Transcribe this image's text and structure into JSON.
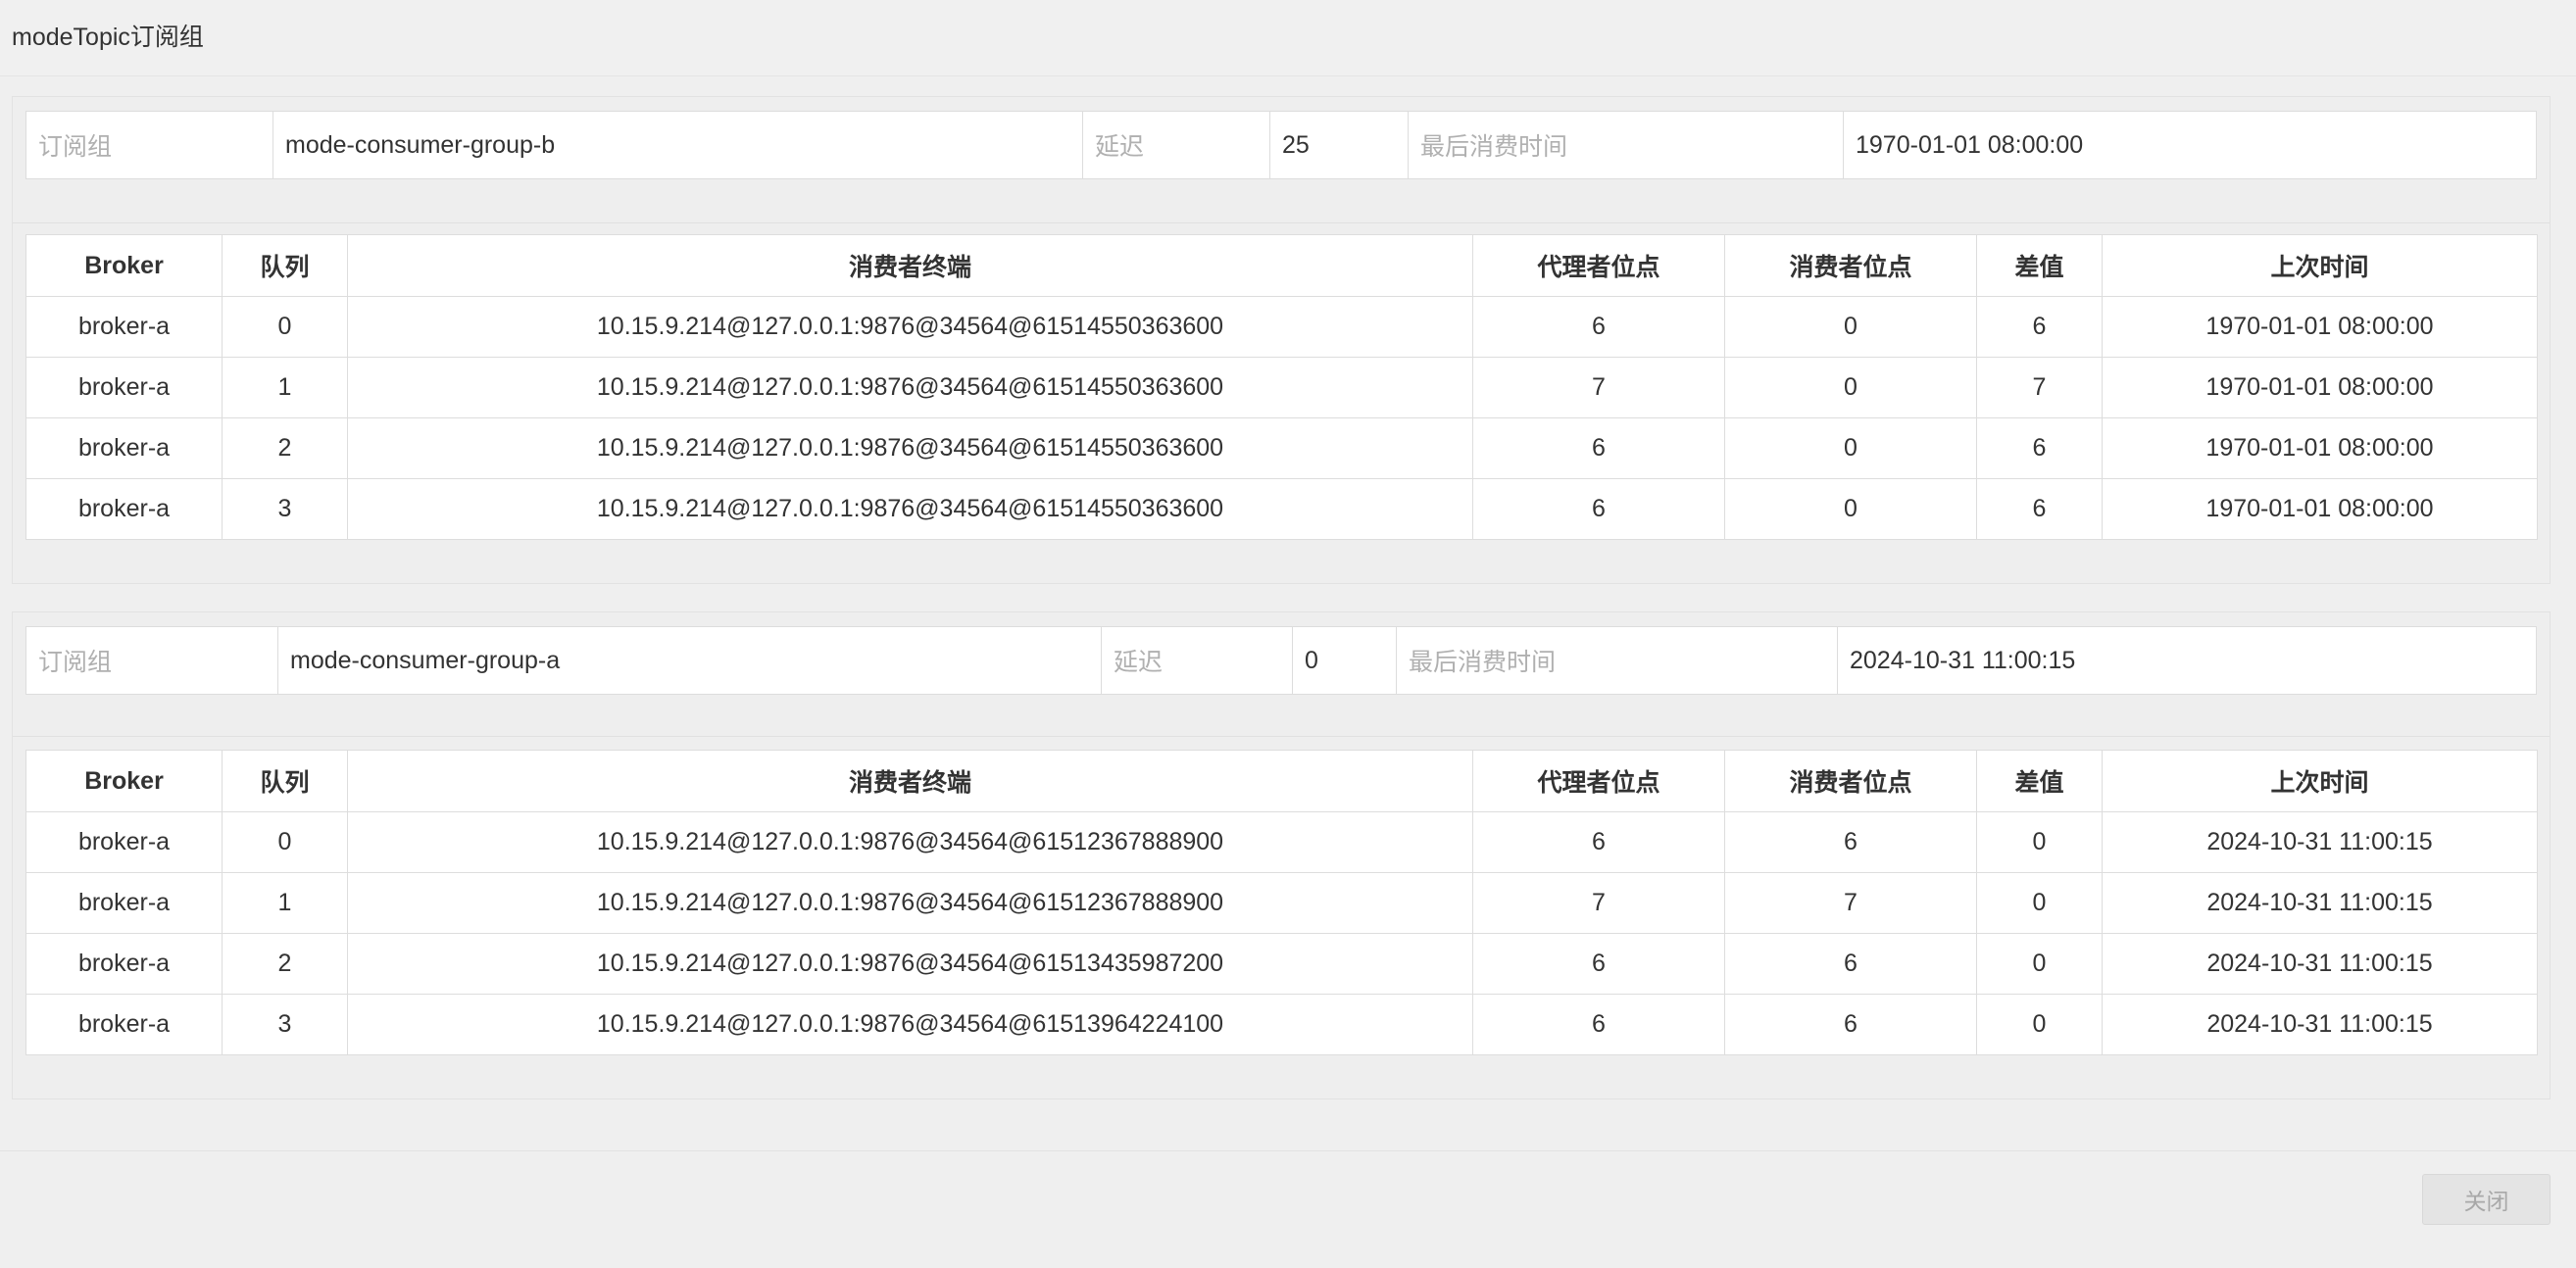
{
  "dialog": {
    "title": "modeTopic订阅组",
    "close_label": "关闭"
  },
  "groups": [
    {
      "group_label": "订阅组",
      "group_value": "mode-consumer-group-b",
      "delay_label": "延迟",
      "delay_value": "25",
      "last_time_label": "最后消费时间",
      "last_time_value": "1970-01-01 08:00:00",
      "table": {
        "headers": [
          "Broker",
          "队列",
          "消费者终端",
          "代理者位点",
          "消费者位点",
          "差值",
          "上次时间"
        ],
        "rows": [
          [
            "broker-a",
            "0",
            "10.15.9.214@127.0.0.1:9876@34564@61514550363600",
            "6",
            "0",
            "6",
            "1970-01-01 08:00:00"
          ],
          [
            "broker-a",
            "1",
            "10.15.9.214@127.0.0.1:9876@34564@61514550363600",
            "7",
            "0",
            "7",
            "1970-01-01 08:00:00"
          ],
          [
            "broker-a",
            "2",
            "10.15.9.214@127.0.0.1:9876@34564@61514550363600",
            "6",
            "0",
            "6",
            "1970-01-01 08:00:00"
          ],
          [
            "broker-a",
            "3",
            "10.15.9.214@127.0.0.1:9876@34564@61514550363600",
            "6",
            "0",
            "6",
            "1970-01-01 08:00:00"
          ]
        ]
      }
    },
    {
      "group_label": "订阅组",
      "group_value": "mode-consumer-group-a",
      "delay_label": "延迟",
      "delay_value": "0",
      "last_time_label": "最后消费时间",
      "last_time_value": "2024-10-31 11:00:15",
      "table": {
        "headers": [
          "Broker",
          "队列",
          "消费者终端",
          "代理者位点",
          "消费者位点",
          "差值",
          "上次时间"
        ],
        "rows": [
          [
            "broker-a",
            "0",
            "10.15.9.214@127.0.0.1:9876@34564@61512367888900",
            "6",
            "6",
            "0",
            "2024-10-31 11:00:15"
          ],
          [
            "broker-a",
            "1",
            "10.15.9.214@127.0.0.1:9876@34564@61512367888900",
            "7",
            "7",
            "0",
            "2024-10-31 11:00:15"
          ],
          [
            "broker-a",
            "2",
            "10.15.9.214@127.0.0.1:9876@34564@61513435987200",
            "6",
            "6",
            "0",
            "2024-10-31 11:00:15"
          ],
          [
            "broker-a",
            "3",
            "10.15.9.214@127.0.0.1:9876@34564@61513964224100",
            "6",
            "6",
            "0",
            "2024-10-31 11:00:15"
          ]
        ]
      }
    }
  ]
}
